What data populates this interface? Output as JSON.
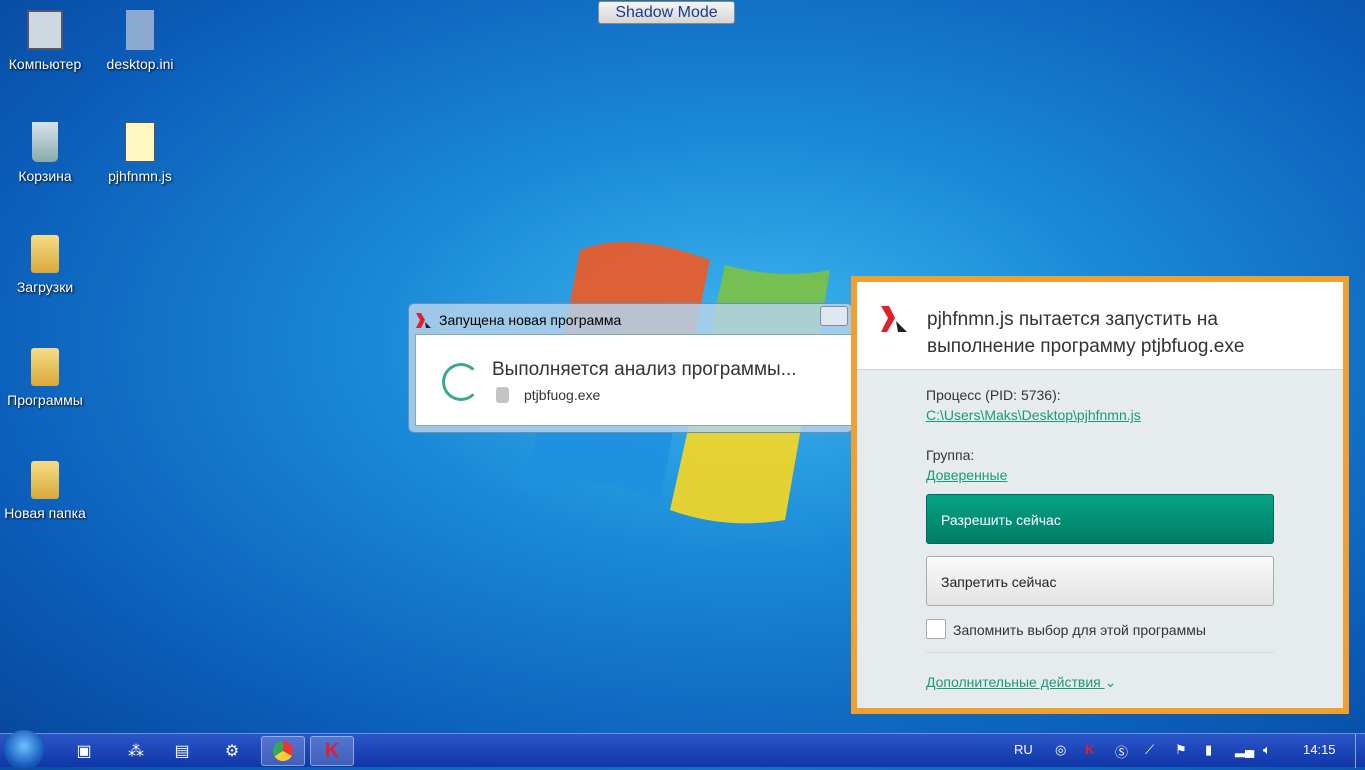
{
  "shadow_mode": "Shadow Mode",
  "desktop_icons": [
    {
      "label": "Компьютер"
    },
    {
      "label": "desktop.ini"
    },
    {
      "label": "Корзина"
    },
    {
      "label": "pjhfnmn.js"
    },
    {
      "label": "Загрузки"
    },
    {
      "label": "Программы"
    },
    {
      "label": "Новая папка"
    }
  ],
  "analysis_window": {
    "title": "Запущена новая программа",
    "status": "Выполняется анализ программы...",
    "file": "ptjbfuog.exe"
  },
  "alert": {
    "headline": "pjhfnmn.js пытается запустить на выполнение программу ptjbfuog.exe",
    "process_label": "Процесс (PID: 5736):",
    "process_path": "C:\\Users\\Maks\\Desktop\\pjhfnmn.js",
    "group_label": "Группа:",
    "group_value": "Доверенные",
    "allow": "Разрешить сейчас",
    "deny": "Запретить сейчас",
    "remember": "Запомнить выбор для этой программы",
    "more": "Дополнительные действия"
  },
  "taskbar": {
    "lang": "RU",
    "time": "14:15"
  },
  "colors": {
    "accent": "#f0a030",
    "allow": "#008a70",
    "link": "#1a9a78"
  }
}
